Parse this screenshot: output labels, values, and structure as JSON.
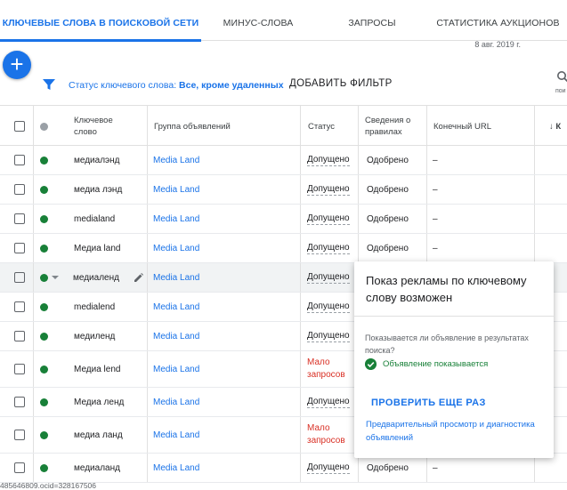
{
  "tabs": [
    {
      "label": "КЛЮЧЕВЫЕ СЛОВА В ПОИСКОВОЙ СЕТИ",
      "active": true
    },
    {
      "label": "МИНУС-СЛОВА",
      "active": false
    },
    {
      "label": "ЗАПРОСЫ",
      "active": false
    },
    {
      "label": "СТАТИСТИКА АУКЦИОНОВ",
      "active": false
    }
  ],
  "date": "8 авг. 2019 г.",
  "toolbar": {
    "fab_label": "+",
    "filter_prefix": "Статус ключевого слова:",
    "filter_value": "Все, кроме удаленных",
    "add_filter": "ДОБАВИТЬ ФИЛЬТР",
    "search_caption": "пои"
  },
  "columns": {
    "keyword": "Ключевое слово",
    "ad_group": "Группа объявлений",
    "status": "Статус",
    "rules": "Сведения о правилах",
    "final_url": "Конечный URL",
    "sorted": "↓ К"
  },
  "rows": [
    {
      "keyword": "медиалэнд",
      "group": "Media Land",
      "status": "Допущено",
      "rules": "Одобрено",
      "url": "–",
      "low": false
    },
    {
      "keyword": "медиа лэнд",
      "group": "Media Land",
      "status": "Допущено",
      "rules": "Одобрено",
      "url": "–",
      "low": false
    },
    {
      "keyword": "medialand",
      "group": "Media Land",
      "status": "Допущено",
      "rules": "Одобрено",
      "url": "–",
      "low": false
    },
    {
      "keyword": "Медиа land",
      "group": "Media Land",
      "status": "Допущено",
      "rules": "Одобрено",
      "url": "–",
      "low": false
    },
    {
      "keyword": "медиаленд",
      "group": "Media Land",
      "status": "Допущено",
      "rules": "",
      "url": "",
      "low": false
    },
    {
      "keyword": "medialend",
      "group": "Media Land",
      "status": "Допущено",
      "rules": "",
      "url": "",
      "low": false
    },
    {
      "keyword": "медиленд",
      "group": "Media Land",
      "status": "Допущено",
      "rules": "",
      "url": "",
      "low": false
    },
    {
      "keyword": "Медиа lend",
      "group": "Media Land",
      "status": "Мало запросов",
      "rules": "",
      "url": "",
      "low": true
    },
    {
      "keyword": "Медиа ленд",
      "group": "Media Land",
      "status": "Допущено",
      "rules": "",
      "url": "",
      "low": false
    },
    {
      "keyword": "медиа ланд",
      "group": "Media Land",
      "status": "Мало запросов",
      "rules": "",
      "url": "",
      "low": true
    },
    {
      "keyword": "медиаланд",
      "group": "Media Land",
      "status": "Допущено",
      "rules": "Одобрено",
      "url": "–",
      "low": false
    }
  ],
  "bottom_text": "485646809.ocid=328167506",
  "tooltip": {
    "title": "Показ рекламы по ключевому слову возможен",
    "question": "Показывается ли объявление в результатах поиска?",
    "answer": "Объявление показывается",
    "button": "ПРОВЕРИТЬ ЕЩЕ РАЗ",
    "link": "Предварительный просмотр и диагностика объявлений"
  },
  "colors": {
    "accent": "#1a73e8",
    "status_green": "#188038",
    "status_red": "#d93025"
  }
}
